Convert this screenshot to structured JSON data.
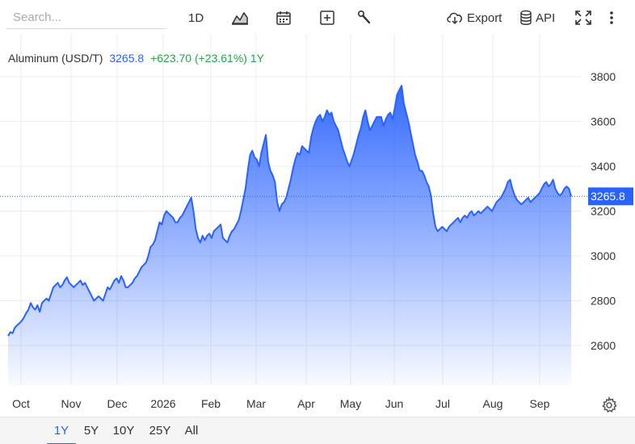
{
  "toolbar": {
    "search_placeholder": "Search...",
    "interval_label": "1D",
    "chart_type_icon": "area-chart-icon",
    "calendar_icon": "calendar-icon",
    "compare_icon": "plus-square-icon",
    "tools_icon": "wrench-icon",
    "export_label": "Export",
    "export_icon": "cloud-download-icon",
    "api_label": "API",
    "api_icon": "database-icon",
    "fullscreen_icon": "fullscreen-icon",
    "more_icon": "more-vertical-icon"
  },
  "legend": {
    "name": "Aluminum (USD/T)",
    "last": "3265.8",
    "change": "+623.70 (+23.61%) 1Y"
  },
  "colors": {
    "line": "#2962ff",
    "fill_top": "#2962ff",
    "up": "#26a645",
    "price_tag": "#2962ff",
    "grid": "#ececec"
  },
  "range_tabs": [
    "1Y",
    "5Y",
    "10Y",
    "25Y",
    "All"
  ],
  "active_range": "1Y",
  "settings_icon": "gear-icon",
  "chart_data": {
    "type": "area",
    "title": "",
    "xlabel": "",
    "ylabel": "",
    "ylim": [
      2420,
      3950
    ],
    "yticks": [
      2600,
      2800,
      3000,
      3200,
      3400,
      3600,
      3800
    ],
    "xticks": [
      "Oct",
      "Nov",
      "Dec",
      "2026",
      "Feb",
      "Mar",
      "Apr",
      "May",
      "Jun",
      "Jul",
      "Aug",
      "Sep"
    ],
    "last_value": 3265.8,
    "grid": true,
    "series": [
      {
        "values": [
          2642,
          2660,
          2655,
          2680,
          2690,
          2700,
          2710,
          2725,
          2745,
          2760,
          2790,
          2770,
          2760,
          2780,
          2750,
          2790,
          2800,
          2810,
          2800,
          2830,
          2860,
          2870,
          2880,
          2860,
          2870,
          2890,
          2905,
          2880,
          2870,
          2860,
          2870,
          2880,
          2890,
          2870,
          2880,
          2860,
          2840,
          2820,
          2800,
          2810,
          2820,
          2810,
          2800,
          2830,
          2860,
          2850,
          2870,
          2890,
          2900,
          2880,
          2910,
          2890,
          2860,
          2860,
          2870,
          2880,
          2900,
          2910,
          2930,
          2950,
          2960,
          2970,
          3000,
          3040,
          3050,
          3070,
          3110,
          3150,
          3140,
          3180,
          3200,
          3190,
          3180,
          3170,
          3150,
          3150,
          3170,
          3180,
          3200,
          3220,
          3240,
          3260,
          3200,
          3120,
          3080,
          3060,
          3090,
          3070,
          3090,
          3100,
          3080,
          3110,
          3120,
          3130,
          3140,
          3080,
          3070,
          3060,
          3090,
          3110,
          3120,
          3140,
          3160,
          3200,
          3250,
          3300,
          3380,
          3450,
          3470,
          3440,
          3430,
          3400,
          3460,
          3500,
          3540,
          3420,
          3380,
          3360,
          3330,
          3240,
          3200,
          3230,
          3240,
          3260,
          3300,
          3340,
          3390,
          3430,
          3460,
          3450,
          3490,
          3480,
          3470,
          3460,
          3530,
          3570,
          3600,
          3620,
          3630,
          3600,
          3620,
          3650,
          3630,
          3640,
          3600,
          3580,
          3560,
          3520,
          3480,
          3450,
          3420,
          3400,
          3430,
          3460,
          3500,
          3540,
          3570,
          3620,
          3650,
          3600,
          3560,
          3580,
          3600,
          3620,
          3620,
          3620,
          3580,
          3610,
          3630,
          3640,
          3610,
          3660,
          3720,
          3740,
          3760,
          3680,
          3640,
          3600,
          3550,
          3500,
          3450,
          3420,
          3380,
          3380,
          3360,
          3330,
          3310,
          3270,
          3190,
          3130,
          3110,
          3120,
          3130,
          3120,
          3110,
          3130,
          3140,
          3150,
          3160,
          3170,
          3150,
          3170,
          3180,
          3170,
          3190,
          3200,
          3180,
          3190,
          3200,
          3190,
          3200,
          3210,
          3220,
          3210,
          3200,
          3220,
          3240,
          3250,
          3260,
          3280,
          3300,
          3330,
          3340,
          3300,
          3270,
          3250,
          3240,
          3230,
          3240,
          3250,
          3260,
          3240,
          3250,
          3260,
          3270,
          3280,
          3300,
          3320,
          3330,
          3310,
          3320,
          3340,
          3300,
          3280,
          3270,
          3280,
          3300,
          3310,
          3300,
          3265.8
        ]
      }
    ]
  }
}
